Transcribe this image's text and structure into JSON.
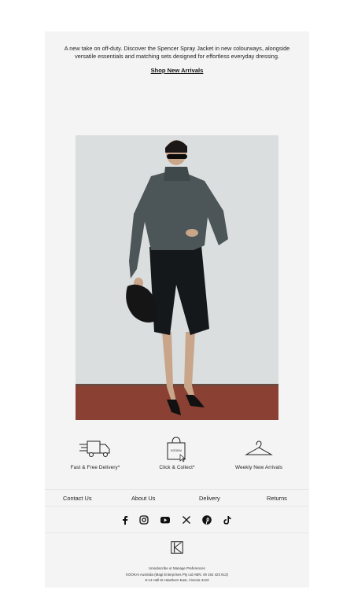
{
  "intro": {
    "text": "A new take on off-duty. Discover the Spencer Spray Jacket in new colourways, alongside versatile essentials and matching sets designed for effortless everyday dressing.",
    "cta_label": "Shop New Arrivals"
  },
  "features": [
    {
      "label": "Fast & Free Delivery*",
      "icon": "delivery-truck-icon"
    },
    {
      "label": "Click & Collect*",
      "icon": "shopping-bag-icon",
      "bag_text": "KOOKAI"
    },
    {
      "label": "Weekly New Arrivals",
      "icon": "clothes-hanger-icon"
    }
  ],
  "nav": {
    "contact": "Contact Us",
    "about": "About Us",
    "delivery": "Delivery",
    "returns": "Returns"
  },
  "social": [
    "facebook-icon",
    "instagram-icon",
    "youtube-icon",
    "x-icon",
    "pinterest-icon",
    "tiktok-icon"
  ],
  "legal": {
    "line1": "Unsubscribe or Manage Preferences",
    "line2": "KOOKAI Australia (Magi Enterprises Pty Ltd ABN: 49 154 423 613)",
    "line3": "8-14 Hall St Hawthorn East, Victoria 3123"
  },
  "colors": {
    "panel": "#f4f4f4",
    "text": "#111111",
    "floor": "#8a4032",
    "wall": "#d8dcdc"
  }
}
